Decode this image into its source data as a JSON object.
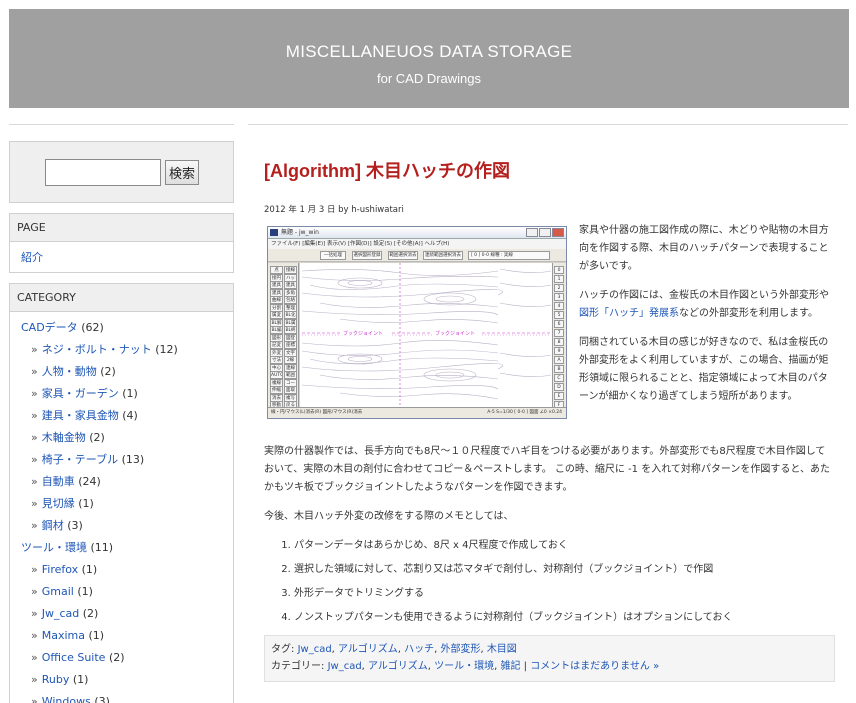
{
  "header": {
    "site_title": "MISCELLANEUOS DATA STORAGE",
    "site_description": "for CAD Drawings",
    "background": "#a0a0a0"
  },
  "sidebar": {
    "search": {
      "value": "",
      "button_label": "検索"
    },
    "page_widget": {
      "title": "PAGE",
      "items": [
        "紹介"
      ]
    },
    "category_widget": {
      "title": "CATEGORY",
      "items": [
        {
          "label": "CADデータ",
          "count": "(62)",
          "level": 0
        },
        {
          "label": "ネジ・ボルト・ナット",
          "count": "(12)",
          "level": 1
        },
        {
          "label": "人物・動物",
          "count": "(2)",
          "level": 1
        },
        {
          "label": "家具・ガーデン",
          "count": "(1)",
          "level": 1
        },
        {
          "label": "建具・家具金物",
          "count": "(4)",
          "level": 1
        },
        {
          "label": "木軸金物",
          "count": "(2)",
          "level": 1
        },
        {
          "label": "椅子・テーブル",
          "count": "(13)",
          "level": 1
        },
        {
          "label": "自動車",
          "count": "(24)",
          "level": 1
        },
        {
          "label": "見切縁",
          "count": "(1)",
          "level": 1
        },
        {
          "label": "鋼材",
          "count": "(3)",
          "level": 1
        },
        {
          "label": "ツール・環境",
          "count": "(11)",
          "level": 0
        },
        {
          "label": "Firefox",
          "count": "(1)",
          "level": 1
        },
        {
          "label": "Gmail",
          "count": "(1)",
          "level": 1
        },
        {
          "label": "Jw_cad",
          "count": "(2)",
          "level": 1
        },
        {
          "label": "Maxima",
          "count": "(1)",
          "level": 1
        },
        {
          "label": "Office Suite",
          "count": "(2)",
          "level": 1
        },
        {
          "label": "Ruby",
          "count": "(1)",
          "level": 1
        },
        {
          "label": "Windows",
          "count": "(3)",
          "level": 1
        }
      ]
    }
  },
  "post": {
    "title": "[Algorithm] 木目ハッチの作図",
    "meta": "2012 年 1 月 3 日 by h-ushiwatari",
    "float_paragraphs": [
      "家具や什器の施工図作成の際に、木どりや貼物の木目方向を作図する際、木目のハッチパターンで表現することが多いです。",
      {
        "before": "ハッチの作図には、金桜氏の木目作図という外部変形や",
        "link": "図形「ハッチ」発展系",
        "after": "などの外部変形を利用します。"
      },
      "同梱されている木目の感じが好きなので、私は金桜氏の外部変形をよく利用していますが、この場合、描画が矩形領域に限られることと、指定領域によって木目のパターンが細かくなり過ぎてしまう短所があります。"
    ],
    "body_paragraphs": [
      "実際の什器製作では、長手方向でも8尺～１０尺程度でハギ目をつける必要があります。外部変形でも8尺程度で木目作図しておいて、実際の木目の剤付に合わせてコピー＆ペーストします。 この時、縮尺に -1 を入れて対称パターンを作図すると、あたかもツキ板でブックジョイントしたようなパターンを作図できます。",
      "今後、木目ハッチ外変の改修をする際のメモとしては、"
    ],
    "list_items": [
      "パターンデータはあらかじめ、8尺 x 4尺程度で作成しておく",
      "選択した領域に対して、芯割り又は芯マタギで剤付し、対称剤付（ブックジョイント）で作図",
      "外形データでトリミングする",
      "ノンストップパターンも使用できるように対称剤付（ブックジョイント）はオプションにしておく"
    ],
    "tags_label": "タグ:",
    "tags": [
      "Jw_cad",
      "アルゴリズム",
      "ハッチ",
      "外部変形",
      "木目図"
    ],
    "categories_label": "カテゴリー:",
    "categories": [
      "Jw_cad",
      "アルゴリズム",
      "ツール・環境",
      "雑記"
    ],
    "comments_link": "コメントはまだありません »",
    "link_color": "#1e56b6",
    "title_color": "#b5201e"
  },
  "cad_screenshot": {
    "window_title": "無題 - jw_win",
    "menu": "ファイル(F)  [編集(E)]  表示(V)  [作図(D)]  設定(S)  [その他(A)]  ヘルプ(H)",
    "toolbar_buttons": [
      "一括処理",
      "選択図形登録",
      "範囲選択消去",
      "連続範囲選択消去"
    ],
    "layer_field": "[ 0 ] 0-0   線種 : 実線",
    "joint_label": "ブックジョイント",
    "left_tools": [
      "点",
      "接線",
      "接円",
      "ハッチ",
      "建具平",
      "建具断",
      "建具立",
      "多角形",
      "曲線",
      "包絡",
      "分割",
      "整理",
      "属変",
      "BL化",
      "BL解",
      "BL属",
      "BL編",
      "BL終",
      "図形",
      "図登",
      "記変",
      "座標",
      "外変",
      "文字",
      "寸法",
      "2線",
      "中心線",
      "連線",
      "AUTO",
      "範囲",
      "複線",
      "コーナー",
      "伸縮",
      "面取",
      "消去",
      "複写",
      "移動",
      "戻る"
    ],
    "right_tools": [
      "0",
      "1",
      "2",
      "3",
      "4",
      "5",
      "6",
      "7",
      "8",
      "9",
      "A",
      "B",
      "C",
      "D",
      "E",
      "F"
    ],
    "status_text": "線・円/マウス(L)消去(R)    図形/マウス(R)消去",
    "status_right": "A-5   S=1/30   [ 0-0 ] 図面   ∠0   ×0.24"
  }
}
